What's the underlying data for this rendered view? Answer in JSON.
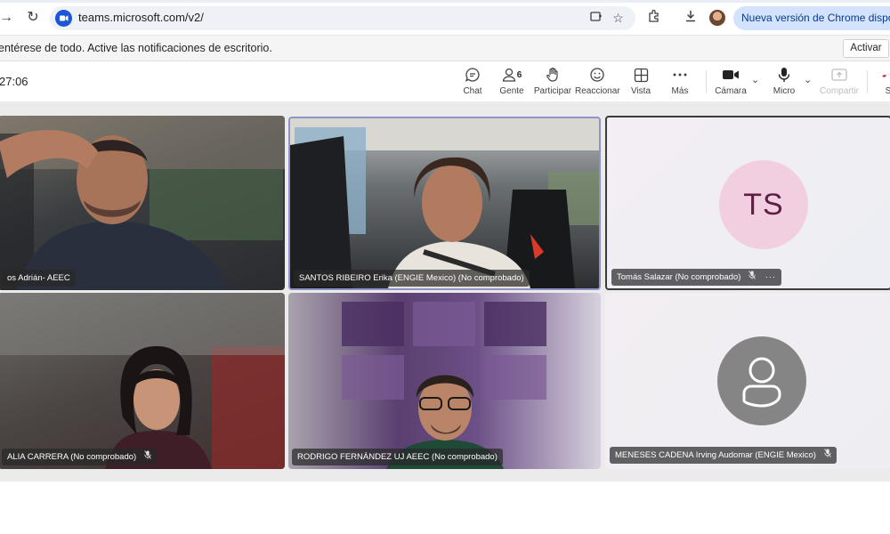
{
  "browser": {
    "url": "teams.microsoft.com/v2/",
    "update_label": "Nueva versión de Chrome disponible"
  },
  "notification": {
    "text": "entérese de todo. Active las notificaciones de escritorio.",
    "button": "Activar"
  },
  "meeting": {
    "timer": "27:06",
    "toolbar": [
      {
        "id": "chat",
        "label": "Chat",
        "icon": "chat-icon"
      },
      {
        "id": "people",
        "label": "Gente",
        "icon": "people-icon",
        "count": "6"
      },
      {
        "id": "raise",
        "label": "Participar",
        "icon": "raise-hand-icon"
      },
      {
        "id": "react",
        "label": "Reaccionar",
        "icon": "smile-icon"
      },
      {
        "id": "view",
        "label": "Vista",
        "icon": "grid-icon"
      },
      {
        "id": "more",
        "label": "Más",
        "icon": "more-icon"
      },
      {
        "id": "camera",
        "label": "Cámara",
        "icon": "camera-icon"
      },
      {
        "id": "mic",
        "label": "Micro",
        "icon": "mic-icon"
      },
      {
        "id": "share",
        "label": "Compartir",
        "icon": "share-icon"
      },
      {
        "id": "leave",
        "label": "S",
        "icon": "leave-icon"
      }
    ]
  },
  "participants": [
    {
      "name": "os Adrián- AEEC"
    },
    {
      "name": "SANTOS RIBEIRO Erika (ENGIE Mexico) (No comprobado)"
    },
    {
      "name": "Tomás Salazar (No comprobado)",
      "initials": "TS"
    },
    {
      "name": "ALIA CARRERA (No comprobado)"
    },
    {
      "name": "RODRIGO FERNÁNDEZ UJ AEEC (No comprobado)"
    },
    {
      "name": "MENESES CADENA Irving Audomar (ENGIE Mexico)"
    }
  ],
  "colors": {
    "active_speaker_border": "#8f92c7",
    "avatar_ts_bg": "#f1cfe0",
    "avatar_ts_text": "#5c1f43",
    "anon_avatar_bg": "#858585",
    "leave_red": "#c4314b"
  }
}
